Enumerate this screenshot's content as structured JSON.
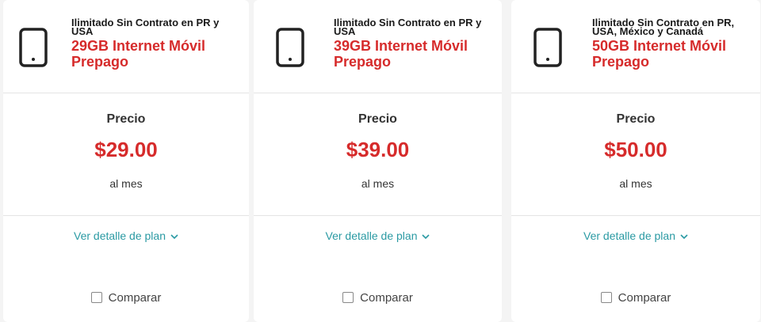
{
  "plans": [
    {
      "subtitle": "Ilimitado Sin Contrato en PR y USA",
      "name": "29GB Internet Móvil Prepago",
      "price_label": "Precio",
      "price": "$29.00",
      "period": "al mes",
      "detail_link": "Ver detalle de plan",
      "compare_label": "Comparar",
      "compare_checked": false
    },
    {
      "subtitle": "Ilimitado Sin Contrato en PR y USA",
      "name": "39GB Internet Móvil Prepago",
      "price_label": "Precio",
      "price": "$39.00",
      "period": "al mes",
      "detail_link": "Ver detalle de plan",
      "compare_label": "Comparar",
      "compare_checked": false
    },
    {
      "subtitle": "Ilimitado Sin Contrato en PR, USA, México y Canadá",
      "name": "50GB Internet Móvil Prepago",
      "price_label": "Precio",
      "price": "$50.00",
      "period": "al mes",
      "detail_link": "Ver detalle de plan",
      "compare_label": "Comparar",
      "compare_checked": false
    }
  ],
  "colors": {
    "accent_red": "#d62b2b",
    "link_teal": "#2a9aa3",
    "divider": "#e4e4e4"
  },
  "icons": {
    "device": "smartphone-icon",
    "expand": "chevron-down-icon"
  }
}
